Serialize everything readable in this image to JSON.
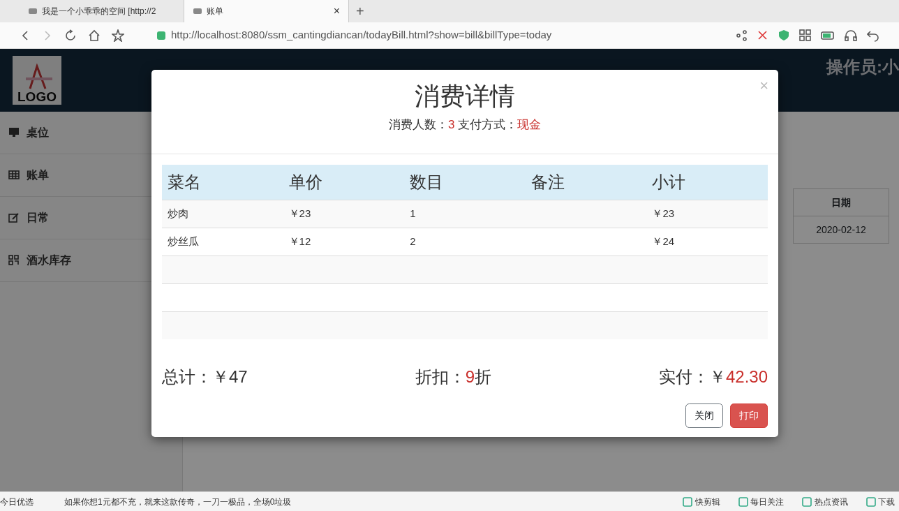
{
  "browser": {
    "tabs": [
      {
        "title": "我是一个小乖乖的空间 [http://2",
        "selected": false
      },
      {
        "title": "账单",
        "selected": true,
        "close": "×"
      }
    ],
    "new_tab": "+",
    "url": "http://localhost:8080/ssm_cantingdiancan/todayBill.html?show=bill&billType=today"
  },
  "header": {
    "logo": "LOGO",
    "operator": "操作员:小"
  },
  "sidebar": {
    "items": [
      {
        "label": "桌位",
        "kind": "monitor"
      },
      {
        "label": "账单",
        "kind": "table"
      },
      {
        "label": "日常",
        "kind": "edit"
      },
      {
        "label": "酒水库存",
        "kind": "qr"
      }
    ]
  },
  "background_table": {
    "columns": [
      "日期"
    ],
    "rows": [
      [
        "2020-02-12"
      ]
    ]
  },
  "modal": {
    "title": "消费详情",
    "close": "×",
    "people_label": "消费人数：",
    "people": "3",
    "payment_label": "支付方式：",
    "payment": "现金",
    "columns": [
      "菜名",
      "单价",
      "数目",
      "备注",
      "小计"
    ],
    "rows": [
      {
        "name": "炒肉",
        "price": "￥23",
        "qty": "1",
        "subtotal": "￥23"
      },
      {
        "name": "炒丝瓜",
        "price": "￥12",
        "qty": "2",
        "subtotal": "￥24"
      }
    ],
    "total_label": "总计：",
    "total": "￥47",
    "discount_label": "折扣：",
    "discount": "9",
    "discount_unit": "折",
    "paid_label": "实付：",
    "paid_currency": "￥",
    "paid": "42.30",
    "buttons": [
      {
        "label": "关闭",
        "kind": "default"
      },
      {
        "label": "打印",
        "kind": "danger"
      }
    ]
  },
  "status_bar": {
    "left": "今日优选",
    "ad": "如果你想1元都不充，就来这款传奇，一刀一极品，全场0垃圾",
    "items": [
      "快剪辑",
      "每日关注",
      "热点资讯",
      "下载"
    ]
  }
}
